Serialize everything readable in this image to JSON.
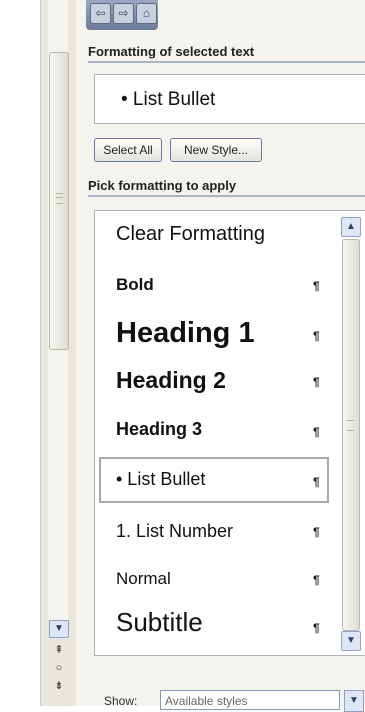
{
  "task_pane": {
    "nav": {
      "back_icon": "back-arrow-icon",
      "forward_icon": "forward-arrow-icon",
      "home_icon": "home-icon"
    },
    "formatting_section_label": "Formatting of selected text",
    "selected_formatting": "•  List Bullet",
    "select_all_label": "Select All",
    "new_style_label": "New Style...",
    "pick_section_label": "Pick formatting to apply",
    "pilcrow": "¶",
    "styles": [
      {
        "label": "Clear Formatting",
        "mark": false,
        "selected": false
      },
      {
        "label": "Bold",
        "mark": true,
        "selected": false
      },
      {
        "label": "Heading 1",
        "mark": true,
        "selected": false
      },
      {
        "label": "Heading 2",
        "mark": true,
        "selected": false
      },
      {
        "label": "Heading 3",
        "mark": true,
        "selected": false
      },
      {
        "label": "•  List Bullet",
        "mark": true,
        "selected": true
      },
      {
        "label": "1.  List Number",
        "mark": true,
        "selected": false
      },
      {
        "label": "Normal",
        "mark": true,
        "selected": false
      },
      {
        "label": "Subtitle",
        "mark": true,
        "selected": false
      }
    ],
    "show_label": "Show:",
    "show_value": "Available styles"
  },
  "colors": {
    "accent": "#aab3c9",
    "pane_background": "#f4f3ee"
  }
}
